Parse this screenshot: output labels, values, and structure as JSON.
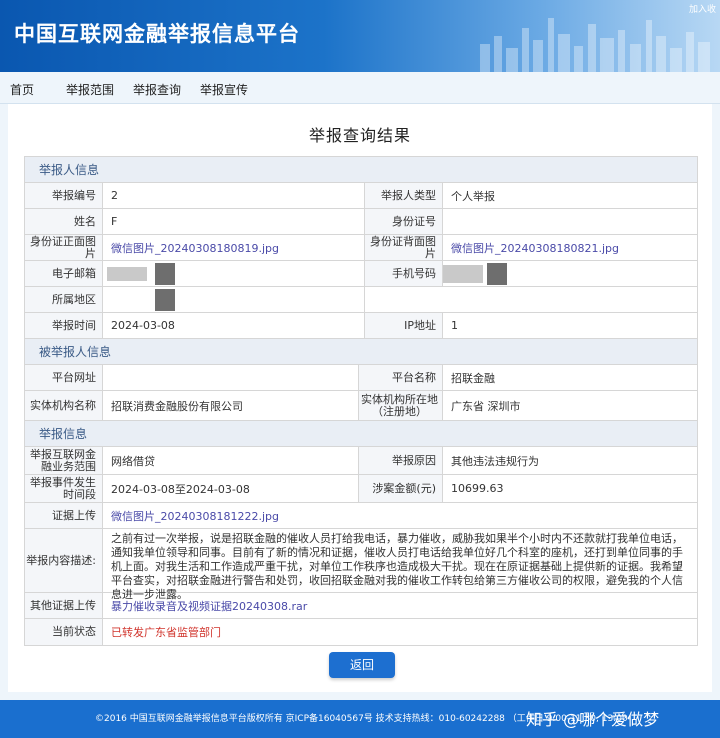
{
  "header": {
    "title": "中国互联网金融举报信息平台",
    "favorite_link": "加入收"
  },
  "nav": [
    "首页",
    "举报范围",
    "举报查询",
    "举报宣传"
  ],
  "page_title": "举报查询结果",
  "reporter": {
    "section_title": "举报人信息",
    "report_no_label": "举报编号",
    "report_no_value": "2",
    "type_label": "举报人类型",
    "type_value": "个人举报",
    "name_label": "姓名",
    "name_value": "F",
    "idcard_label": "身份证号",
    "idfront_label": "身份证正面图片",
    "idfront_file": "微信图片_20240308180819.jpg",
    "idback_label": "身份证背面图片",
    "idback_file": "微信图片_20240308180821.jpg",
    "email_label": "电子邮箱",
    "phone_label": "手机号码",
    "region_label": "所属地区",
    "time_label": "举报时间",
    "time_value": "2024-03-08",
    "ip_label": "IP地址",
    "ip_value": "1"
  },
  "reported": {
    "section_title": "被举报人信息",
    "website_label": "平台网址",
    "platform_label": "平台名称",
    "platform_value": "招联金融",
    "entity_label": "实体机构名称",
    "entity_value": "招联消费金融股份有限公司",
    "location_label": "实体机构所在地（注册地）",
    "location_value": "广东省 深圳市"
  },
  "report": {
    "section_title": "举报信息",
    "category_label": "举报互联网金融业务范围",
    "category_value": "网络借贷",
    "reason_label": "举报原因",
    "reason_value": "其他违法违规行为",
    "period_label": "举报事件发生时间段",
    "period_value": "2024-03-08至2024-03-08",
    "amount_label": "涉案金额(元)",
    "amount_value": "10699.63",
    "evidence_label": "证据上传",
    "evidence_file": "微信图片_20240308181222.jpg",
    "content_label": "举报内容描述:",
    "content_value": "之前有过一次举报，说是招联金融的催收人员打给我电话，暴力催收，威胁我如果半个小时内不还款就打我单位电话，通知我单位领导和同事。目前有了新的情况和证据，催收人员打电话给我单位好几个科室的座机，还打到单位同事的手机上面。对我生活和工作造成严重干扰，对单位工作秩序也造成极大干扰。现在在原证据基础上提供新的证据。我希望平台查实，对招联金融进行警告和处罚，收回招联金融对我的催收工作转包给第三方催收公司的权限，避免我的个人信息进一步泄露。",
    "other_label": "其他证据上传",
    "other_file": "暴力催收录音及视频证据20240308.rar",
    "status_label": "当前状态",
    "status_value": "已转发广东省监管部门"
  },
  "button_back": "返回",
  "footer": {
    "copyright": "©2016 中国互联网金融举报信息平台版权所有 京ICP备16040567号 技术支持热线：010-60242288 （工作日 9:00-11:30, 13:00-",
    "watermark": "知乎 @哪个爱做梦"
  },
  "colors": {
    "banner": "#1c73c9",
    "section_header": "#3a5a86",
    "link": "#4a4aa8",
    "status_red": "#d0342c",
    "button": "#1d6fd0",
    "footer": "#1a6fcf"
  }
}
